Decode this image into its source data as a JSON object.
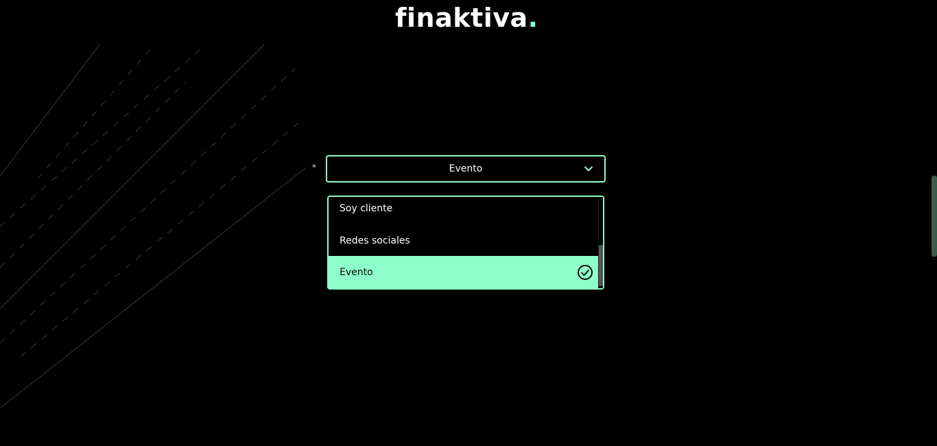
{
  "brand": {
    "name": "finaktiva",
    "dot": ".",
    "accent_color": "#8effc8"
  },
  "form": {
    "required_mark": "*",
    "select": {
      "value": "Evento",
      "icon": "chevron-down-icon"
    },
    "options": [
      {
        "label": "Soy cliente",
        "selected": false
      },
      {
        "label": "Redes sociales",
        "selected": false
      },
      {
        "label": "Evento",
        "selected": true,
        "icon": "check-circle-icon"
      }
    ]
  }
}
